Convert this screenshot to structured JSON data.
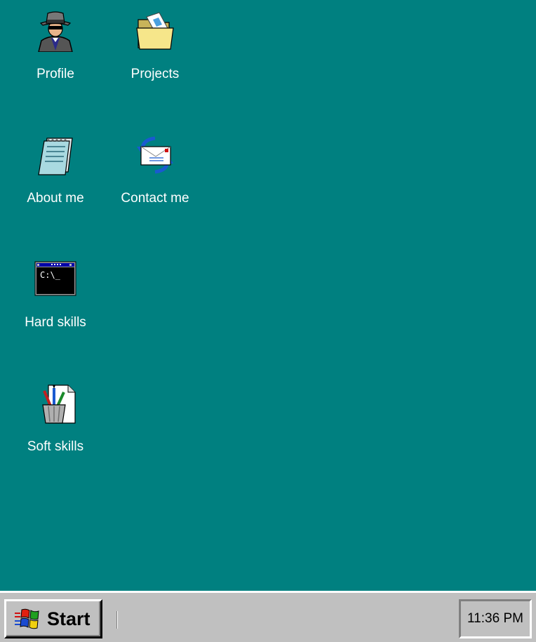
{
  "desktop": {
    "background_color": "#008080",
    "icons": [
      {
        "label": "Profile",
        "icon": "spy-agent-icon"
      },
      {
        "label": "Projects",
        "icon": "folder-icon"
      },
      {
        "label": "About me",
        "icon": "notepad-icon"
      },
      {
        "label": "Contact me",
        "icon": "mail-icon"
      },
      {
        "label": "Hard skills",
        "icon": "command-prompt-icon"
      },
      {
        "label": "Soft skills",
        "icon": "art-supplies-icon"
      }
    ]
  },
  "taskbar": {
    "start_label": "Start",
    "clock": "11:36 PM",
    "background_color": "#c0c0c0"
  }
}
